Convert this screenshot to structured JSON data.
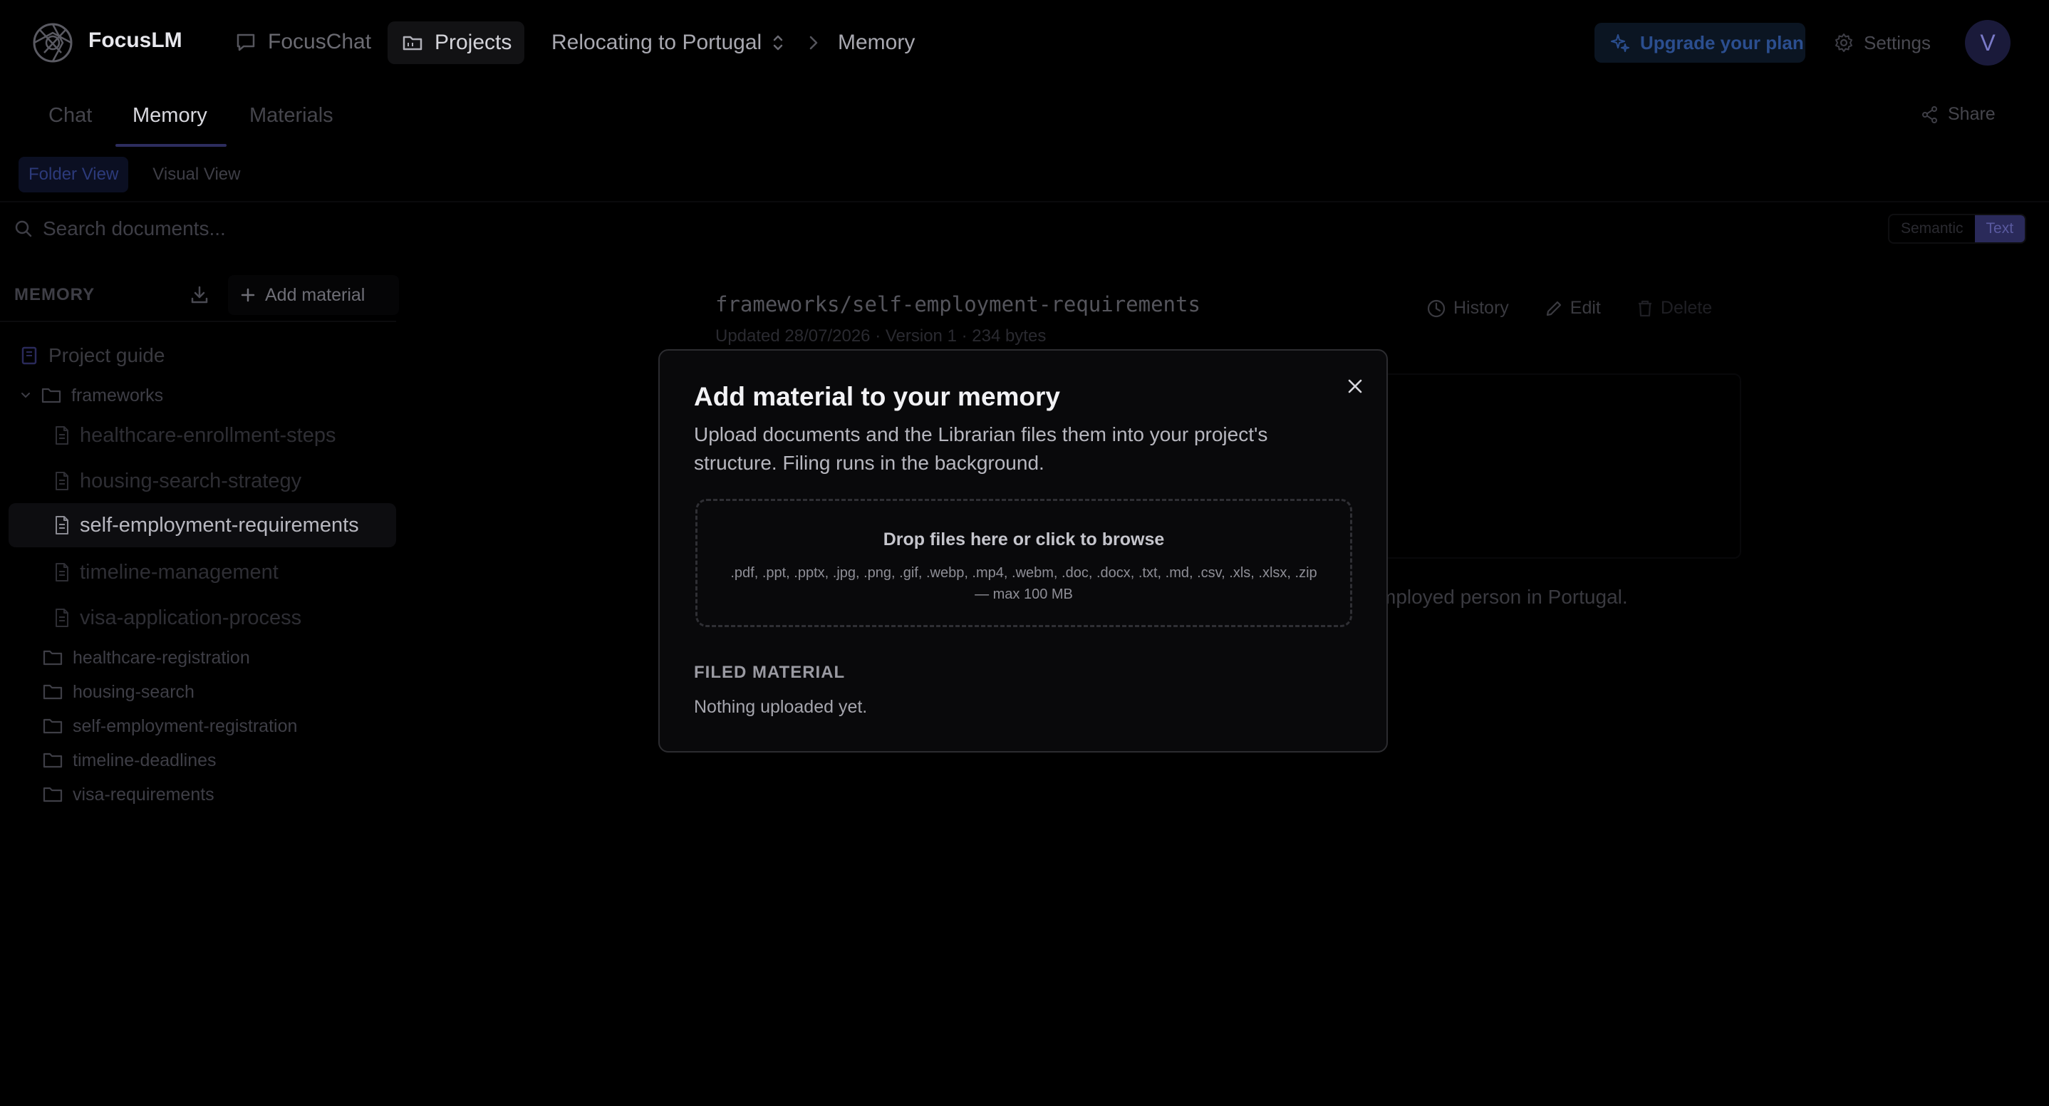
{
  "app": {
    "name": "FocusLM"
  },
  "nav": {
    "focuschat": "FocusChat",
    "projects": "Projects",
    "project_name": "Relocating to Portugal",
    "breadcrumb_current": "Memory",
    "upgrade": "Upgrade your plan",
    "settings": "Settings",
    "avatar_initial": "V"
  },
  "tabs": {
    "chat": "Chat",
    "memory": "Memory",
    "materials": "Materials",
    "share": "Share"
  },
  "view": {
    "folder": "Folder View",
    "visual": "Visual View"
  },
  "search": {
    "placeholder": "Search documents...",
    "semantic": "Semantic",
    "text": "Text"
  },
  "sidebar": {
    "header": "MEMORY",
    "add_material": "Add material",
    "project_guide": "Project guide",
    "folders": [
      {
        "name": "frameworks",
        "files": [
          "healthcare-enrollment-steps",
          "housing-search-strategy",
          "self-employment-requirements",
          "timeline-management",
          "visa-application-process"
        ]
      },
      {
        "name": "healthcare-registration"
      },
      {
        "name": "housing-search"
      },
      {
        "name": "self-employment-registration"
      },
      {
        "name": "timeline-deadlines"
      },
      {
        "name": "visa-requirements"
      }
    ]
  },
  "document": {
    "path": "frameworks/self-employment-requirements",
    "meta": "Updated 28/07/2026 · Version 1 · 234 bytes",
    "history": "History",
    "edit": "Edit",
    "delete": "Delete",
    "body_fragment": "mployed person in Portugal."
  },
  "modal": {
    "title": "Add material to your memory",
    "description": "Upload documents and the Librarian files them into your project's structure. Filing runs in the background.",
    "drop_title": "Drop files here or click to browse",
    "drop_types": ".pdf, .ppt, .pptx, .jpg, .png, .gif, .webp, .mp4, .webm, .doc, .docx, .txt, .md, .csv, .xls, .xlsx, .zip — max 100 MB",
    "filed_label": "FILED MATERIAL",
    "filed_empty": "Nothing uploaded yet."
  }
}
